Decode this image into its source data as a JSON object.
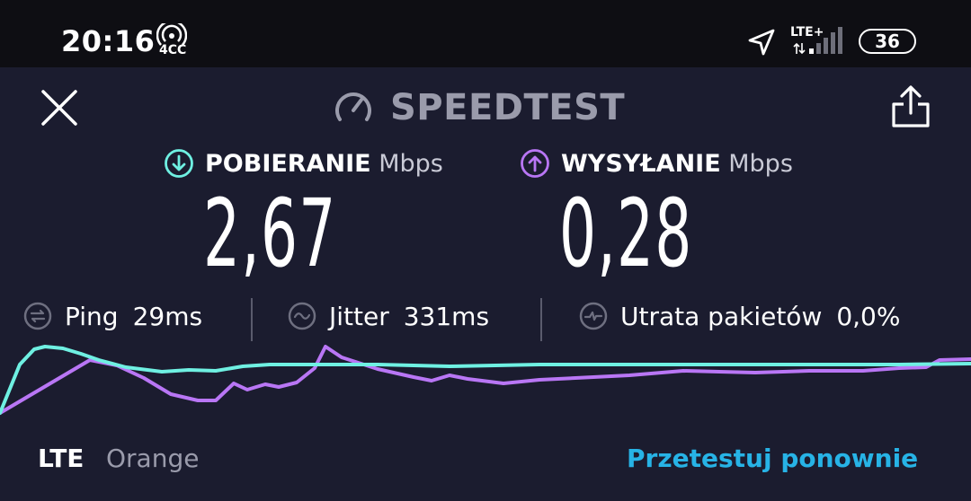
{
  "status_bar": {
    "time": "20:16",
    "hotspot_label": "4CC",
    "network_label": "LTE+",
    "battery": "36",
    "icons": [
      "hotspot-icon",
      "location-icon",
      "data-arrows-icon",
      "signal-icon",
      "battery-icon"
    ]
  },
  "header": {
    "title": "SPEEDTEST",
    "icons": [
      "close-icon",
      "gauge-icon",
      "share-icon"
    ]
  },
  "download": {
    "label": "POBIERANIE",
    "unit": "Mbps",
    "value": "2,67",
    "color": "#6ff0e2"
  },
  "upload": {
    "label": "WYSYŁANIE",
    "unit": "Mbps",
    "value": "0,28",
    "color": "#b976f5"
  },
  "stats": {
    "ping_label": "Ping",
    "ping_value": "29ms",
    "jitter_label": "Jitter",
    "jitter_value": "331ms",
    "loss_label": "Utrata pakietów",
    "loss_value": "0,0%"
  },
  "footer": {
    "network_type": "LTE",
    "carrier": "Orange",
    "retest_label": "Przetestuj ponownie",
    "retest_color": "#27b3e6"
  }
}
